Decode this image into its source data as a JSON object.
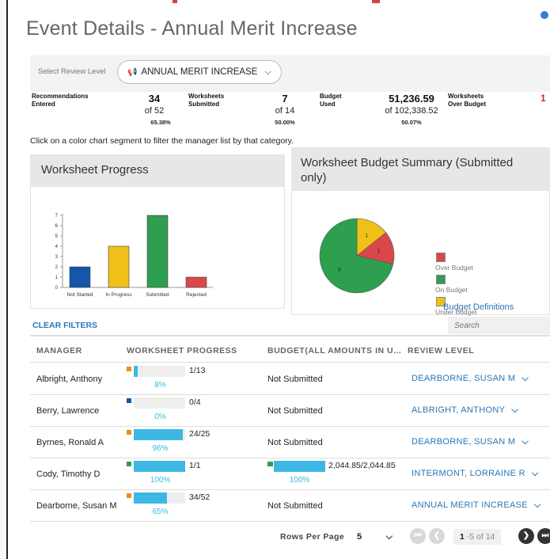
{
  "header": {
    "title": "Event Details - Annual Merit Increase"
  },
  "review_level": {
    "label": "Select Review Level",
    "selected": "ANNUAL MERIT INCREASE"
  },
  "stats": {
    "recommendations": {
      "label_1": "Recommendations",
      "label_2": "Entered",
      "value": "34",
      "of": "of 52",
      "pct": "65.38%"
    },
    "worksheets_submitted": {
      "label_1": "Worksheets",
      "label_2": "Submitted",
      "value": "7",
      "of": "of 14",
      "pct": "50.00%"
    },
    "budget_used": {
      "label_1": "Budget",
      "label_2": "Used",
      "value": "51,236.59",
      "of": "of 102,338.52",
      "pct": "50.07%"
    },
    "over_budget": {
      "label_1": "Worksheets",
      "label_2": "Over Budget",
      "value": "1"
    }
  },
  "instruction": "Click on a color chart segment to filter the manager list by that category.",
  "worksheet_progress": {
    "title": "Worksheet Progress"
  },
  "budget_summary": {
    "title": "Worksheet Budget Summary (Submitted only)",
    "legend": [
      "Over Budget",
      "On Budget",
      "Under Budget"
    ],
    "definitions_link": "Budget Definitions"
  },
  "colors": {
    "blue": "#1556a8",
    "yellow": "#f0c01a",
    "green": "#2e9e4f",
    "red": "#d9474b",
    "accent": "#2a77b6",
    "progress": "#3db8e4"
  },
  "chart_data": [
    {
      "type": "bar",
      "title": "Worksheet Progress",
      "categories": [
        "Not Started",
        "In Progress",
        "Submitted",
        "Rejected"
      ],
      "values": [
        2,
        4,
        7,
        1
      ],
      "colors": [
        "#1556a8",
        "#f0c01a",
        "#2e9e4f",
        "#d9474b"
      ],
      "yticks": [
        "0",
        "1",
        "2",
        "3",
        "4",
        "5",
        "6",
        "7"
      ],
      "ylim": [
        0,
        7
      ],
      "grid": false
    },
    {
      "type": "pie",
      "title": "Worksheet Budget Summary (Submitted only)",
      "labels": [
        "Over Budget",
        "On Budget",
        "Under Budget"
      ],
      "values": [
        1,
        5,
        1
      ],
      "value_labels": [
        "1",
        "5",
        "1"
      ],
      "colors": [
        "#d9474b",
        "#2e9e4f",
        "#f0c01a"
      ]
    }
  ],
  "filters": {
    "clear": "CLEAR FILTERS",
    "search_placeholder": "Search"
  },
  "table": {
    "headers": [
      "MANAGER",
      "WORKSHEET PROGRESS",
      "BUDGET(ALL AMOUNTS IN U...",
      "REVIEW LEVEL"
    ],
    "rows": [
      {
        "manager": "Albright, Anthony",
        "progress_fraction": 0.08,
        "progress_text": "1/13",
        "progress_pct": "8%",
        "flag_color": "#f08c1a",
        "budget": "Not Submitted",
        "review_level": "DEARBORNE, SUSAN M"
      },
      {
        "manager": "Berry, Lawrence",
        "progress_fraction": 0.0,
        "progress_text": "0/4",
        "progress_pct": "0%",
        "flag_color": "#1556a8",
        "budget": "Not Submitted",
        "review_level": "ALBRIGHT, ANTHONY"
      },
      {
        "manager": "Byrnes, Ronald A",
        "progress_fraction": 0.96,
        "progress_text": "24/25",
        "progress_pct": "96%",
        "flag_color": "#f08c1a",
        "budget": "Not Submitted",
        "review_level": "DEARBORNE, SUSAN M"
      },
      {
        "manager": "Cody, Timothy D",
        "progress_fraction": 1.0,
        "progress_text": "1/1",
        "progress_pct": "100%",
        "flag_color": "#2e9e4f",
        "budget": "2,044.85/2,044.85",
        "budget_pct": "100%",
        "budget_fraction": 1.0,
        "review_level": "INTERMONT, LORRAINE R"
      },
      {
        "manager": "Dearborne, Susan M",
        "progress_fraction": 0.65,
        "progress_text": "34/52",
        "progress_pct": "65%",
        "flag_color": "#f08c1a",
        "budget": "Not Submitted",
        "review_level": "ANNUAL MERIT INCREASE"
      }
    ]
  },
  "pager": {
    "label": "Rows Per Page",
    "rows_value": "5",
    "current": "1",
    "range": "-5 of 14"
  }
}
